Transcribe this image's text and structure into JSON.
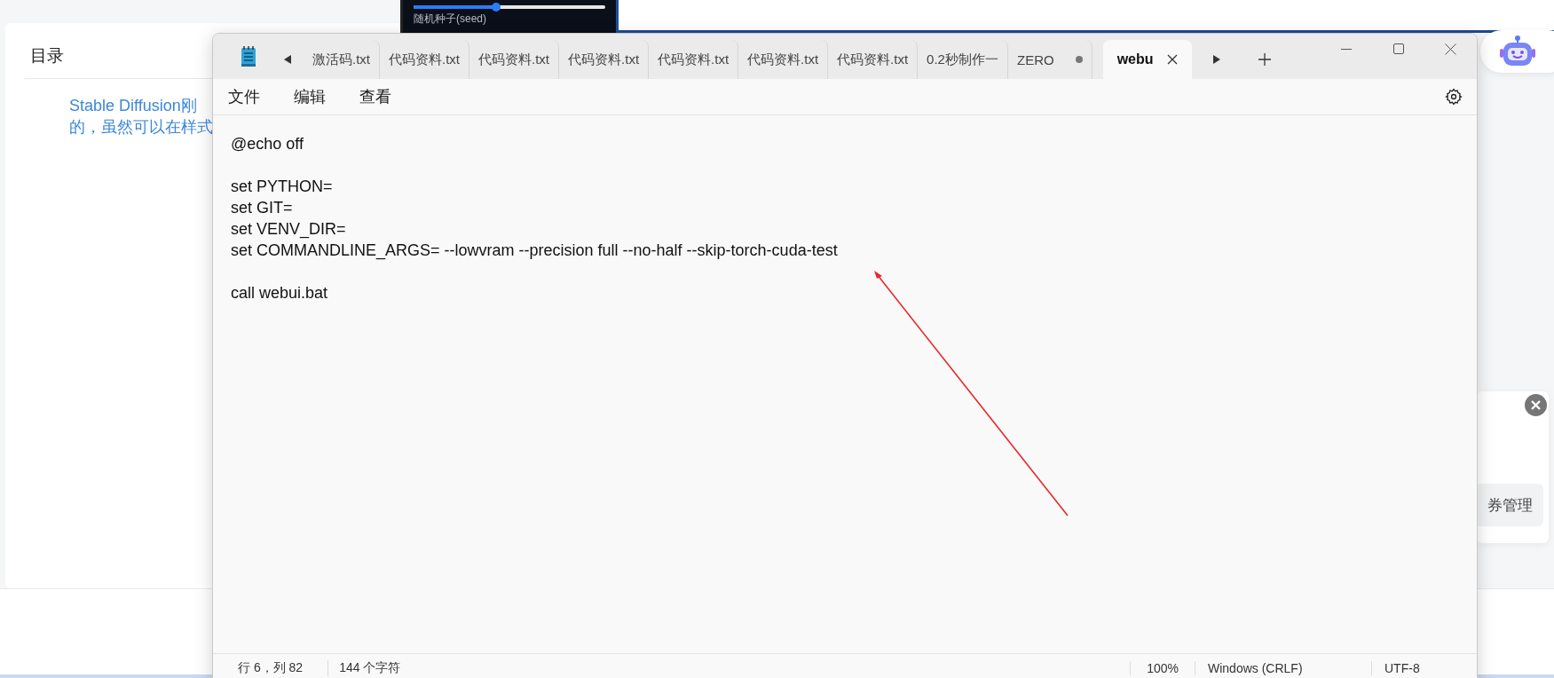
{
  "background_page": {
    "toc_title": "目录",
    "toc_link_lines": [
      "Stable Diffusion刚",
      "的，虽然可以在样式"
    ],
    "preview": {
      "label": "随机种子(seed)",
      "level": 0.43
    },
    "side_card": {
      "button": "券管理"
    }
  },
  "notepad": {
    "tabs": [
      {
        "label": "激活码.txt",
        "selected": false,
        "modified": false
      },
      {
        "label": "代码资料.txt",
        "selected": false,
        "modified": false
      },
      {
        "label": "代码资料.txt",
        "selected": false,
        "modified": false
      },
      {
        "label": "代码资料.txt",
        "selected": false,
        "modified": false
      },
      {
        "label": "代码资料.txt",
        "selected": false,
        "modified": false
      },
      {
        "label": "代码资料.txt",
        "selected": false,
        "modified": false
      },
      {
        "label": "代码资料.txt",
        "selected": false,
        "modified": false
      },
      {
        "label": "0.2秒制作一",
        "selected": false,
        "modified": false
      },
      {
        "label": "ZERO",
        "selected": false,
        "modified": true
      },
      {
        "label": "webu",
        "selected": true,
        "modified": false
      }
    ],
    "menu": [
      "文件",
      "编辑",
      "查看"
    ],
    "paragraphs": [
      [
        "@echo off"
      ],
      [
        "set PYTHON=",
        "set GIT=",
        "set VENV_DIR=",
        "set COMMANDLINE_ARGS= --lowvram --precision full --no-half --skip-torch-cuda-test"
      ],
      [
        "call webui.bat"
      ]
    ],
    "status_bar": {
      "position": "行 6，列 82",
      "characters": "144 个字符",
      "zoom": "100%",
      "line_ending": "Windows (CRLF)",
      "encoding": "UTF-8"
    }
  }
}
